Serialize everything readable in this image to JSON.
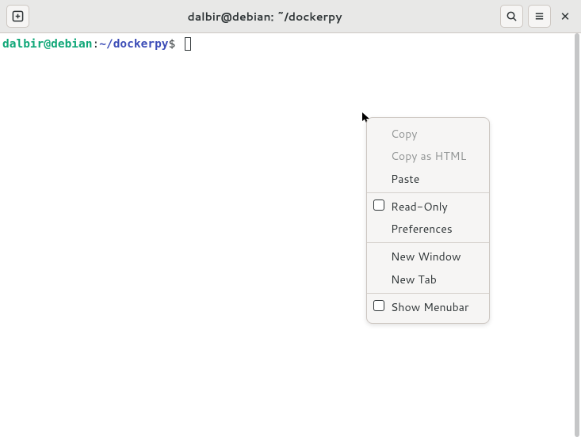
{
  "titlebar": {
    "title": "dalbir@debian: ~/dockerpy"
  },
  "prompt": {
    "user": "dalbir@debian",
    "colon": ":",
    "path": "~/dockerpy",
    "dollar": "$"
  },
  "menu": {
    "copy": "Copy",
    "copy_html": "Copy as HTML",
    "paste": "Paste",
    "read_only": "Read-Only",
    "preferences": "Preferences",
    "new_window": "New Window",
    "new_tab": "New Tab",
    "show_menubar": "Show Menubar"
  }
}
